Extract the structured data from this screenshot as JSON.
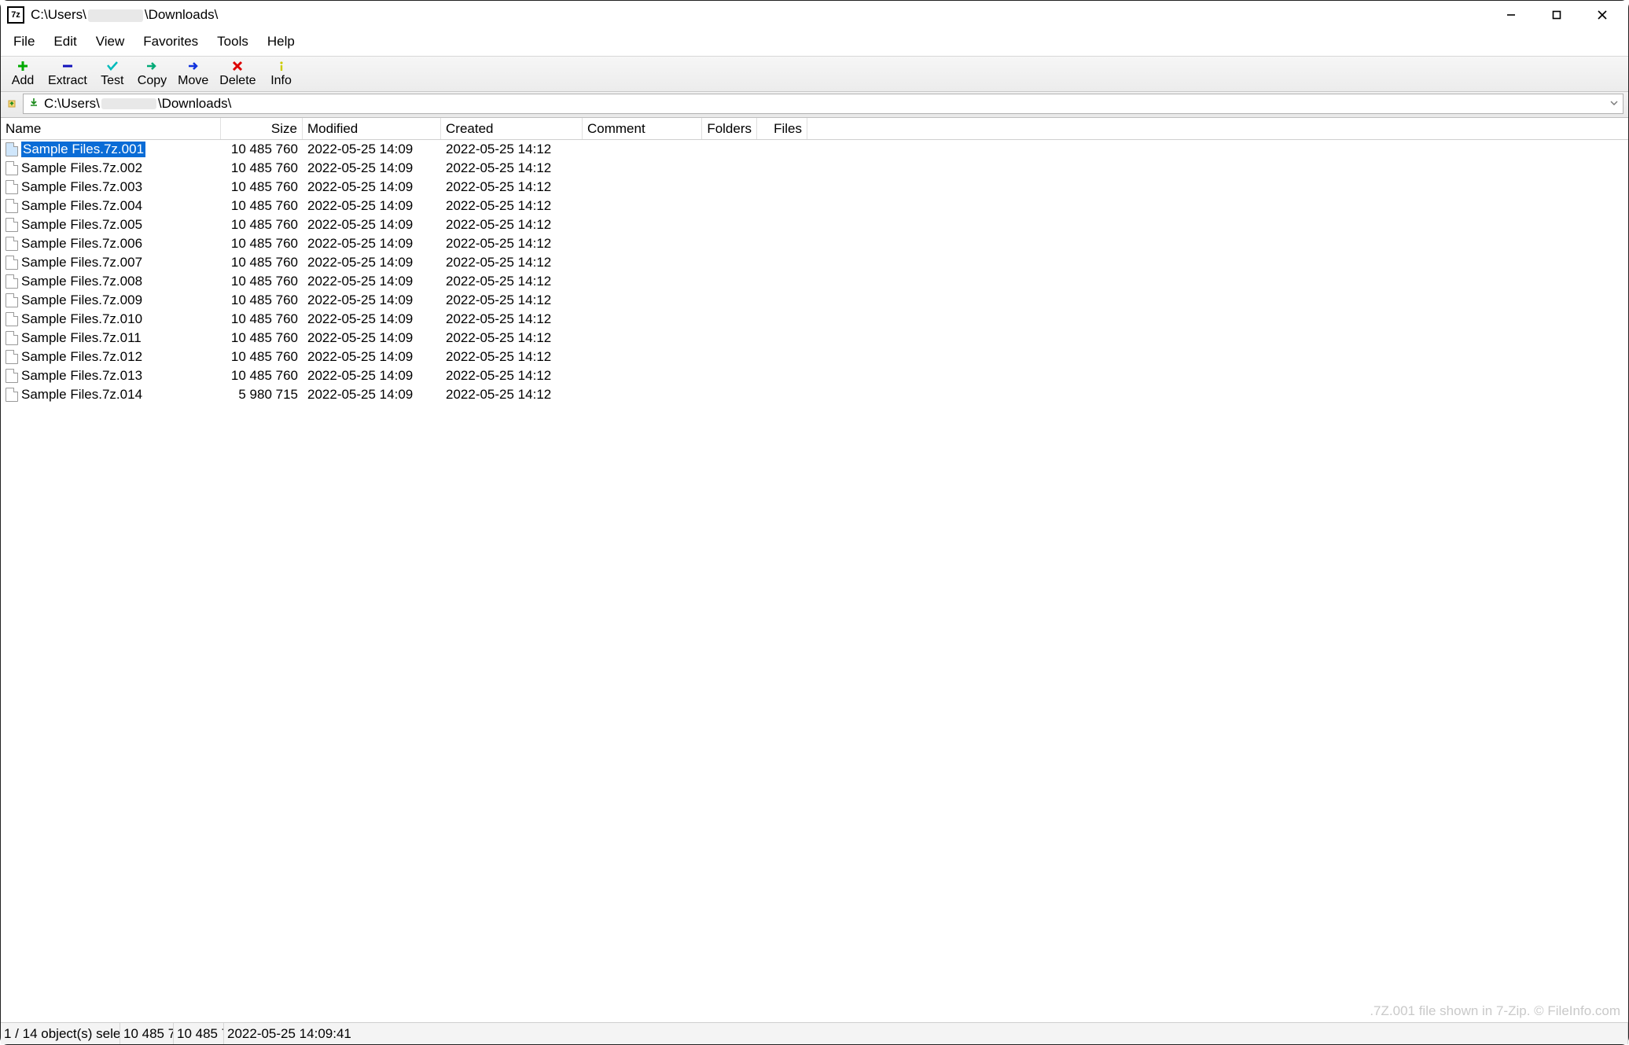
{
  "window": {
    "title_prefix": "C:\\Users\\",
    "title_suffix": "\\Downloads\\"
  },
  "menus": [
    "File",
    "Edit",
    "View",
    "Favorites",
    "Tools",
    "Help"
  ],
  "toolbar": [
    {
      "id": "add",
      "label": "Add",
      "icon": "plus"
    },
    {
      "id": "extract",
      "label": "Extract",
      "icon": "minus"
    },
    {
      "id": "test",
      "label": "Test",
      "icon": "check"
    },
    {
      "id": "copy",
      "label": "Copy",
      "icon": "arrow-right-green"
    },
    {
      "id": "move",
      "label": "Move",
      "icon": "arrow-right-blue"
    },
    {
      "id": "delete",
      "label": "Delete",
      "icon": "x"
    },
    {
      "id": "info",
      "label": "Info",
      "icon": "info"
    }
  ],
  "address": {
    "prefix": "C:\\Users\\",
    "suffix": "\\Downloads\\"
  },
  "columns": {
    "name": "Name",
    "size": "Size",
    "modified": "Modified",
    "created": "Created",
    "comment": "Comment",
    "folders": "Folders",
    "files": "Files"
  },
  "files": [
    {
      "name": "Sample Files.7z.001",
      "size": "10 485 760",
      "modified": "2022-05-25 14:09",
      "created": "2022-05-25 14:12",
      "selected": true
    },
    {
      "name": "Sample Files.7z.002",
      "size": "10 485 760",
      "modified": "2022-05-25 14:09",
      "created": "2022-05-25 14:12"
    },
    {
      "name": "Sample Files.7z.003",
      "size": "10 485 760",
      "modified": "2022-05-25 14:09",
      "created": "2022-05-25 14:12"
    },
    {
      "name": "Sample Files.7z.004",
      "size": "10 485 760",
      "modified": "2022-05-25 14:09",
      "created": "2022-05-25 14:12"
    },
    {
      "name": "Sample Files.7z.005",
      "size": "10 485 760",
      "modified": "2022-05-25 14:09",
      "created": "2022-05-25 14:12"
    },
    {
      "name": "Sample Files.7z.006",
      "size": "10 485 760",
      "modified": "2022-05-25 14:09",
      "created": "2022-05-25 14:12"
    },
    {
      "name": "Sample Files.7z.007",
      "size": "10 485 760",
      "modified": "2022-05-25 14:09",
      "created": "2022-05-25 14:12"
    },
    {
      "name": "Sample Files.7z.008",
      "size": "10 485 760",
      "modified": "2022-05-25 14:09",
      "created": "2022-05-25 14:12"
    },
    {
      "name": "Sample Files.7z.009",
      "size": "10 485 760",
      "modified": "2022-05-25 14:09",
      "created": "2022-05-25 14:12"
    },
    {
      "name": "Sample Files.7z.010",
      "size": "10 485 760",
      "modified": "2022-05-25 14:09",
      "created": "2022-05-25 14:12"
    },
    {
      "name": "Sample Files.7z.011",
      "size": "10 485 760",
      "modified": "2022-05-25 14:09",
      "created": "2022-05-25 14:12"
    },
    {
      "name": "Sample Files.7z.012",
      "size": "10 485 760",
      "modified": "2022-05-25 14:09",
      "created": "2022-05-25 14:12"
    },
    {
      "name": "Sample Files.7z.013",
      "size": "10 485 760",
      "modified": "2022-05-25 14:09",
      "created": "2022-05-25 14:12"
    },
    {
      "name": "Sample Files.7z.014",
      "size": "5 980 715",
      "modified": "2022-05-25 14:09",
      "created": "2022-05-25 14:12"
    }
  ],
  "watermark": ".7Z.001 file shown in 7-Zip. © FileInfo.com",
  "status": {
    "selection": "1 / 14 object(s) selec",
    "sel_size": "10 485 7",
    "tot_size": "10 485 7",
    "datetime": "2022-05-25 14:09:41"
  }
}
